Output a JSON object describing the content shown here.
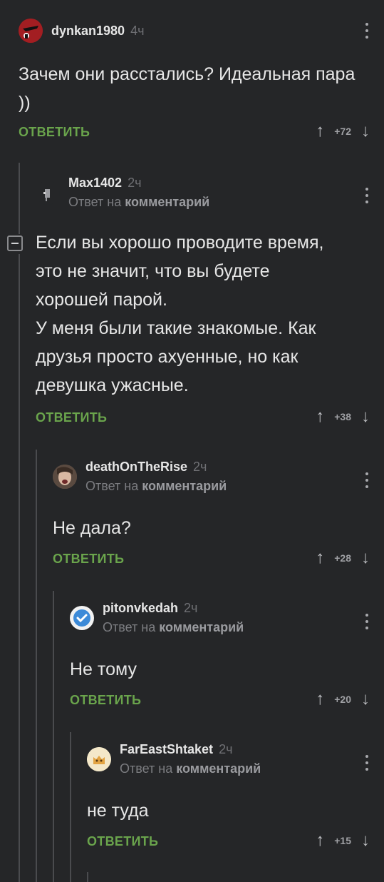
{
  "reply_to_prefix": "Ответ на",
  "reply_to_target": "комментарий",
  "reply_label": "ОТВЕТИТЬ",
  "upvote_icon": "↑",
  "downvote_icon": "↓",
  "comments": [
    {
      "username": "dynkan1980",
      "time": "4ч",
      "avatar_icon": "red-avatar-icon",
      "text": "Зачем они расстались? Идеальная пара ))",
      "score": "+72"
    },
    {
      "username": "Max1402",
      "time": "2ч",
      "avatar_icon": "figure-avatar-icon",
      "text_lines": [
        "Если вы хорошо проводите время,",
        "это не значит, что вы будете",
        "хорошей парой.",
        "У меня были такие знакомые. Как",
        "друзья просто ахуенные, но как",
        "девушка ужасные."
      ],
      "score": "+38"
    },
    {
      "username": "deathOnTheRise",
      "time": "2ч",
      "avatar_icon": "face-avatar-icon",
      "text": "Не дала?",
      "score": "+28"
    },
    {
      "username": "pitonvkedah",
      "time": "2ч",
      "avatar_icon": "verified-check-icon",
      "text": "Не тому",
      "score": "+20"
    },
    {
      "username": "FarEastShtaket",
      "time": "2ч",
      "avatar_icon": "cat-avatar-icon",
      "text": "не туда",
      "score": "+15"
    }
  ]
}
